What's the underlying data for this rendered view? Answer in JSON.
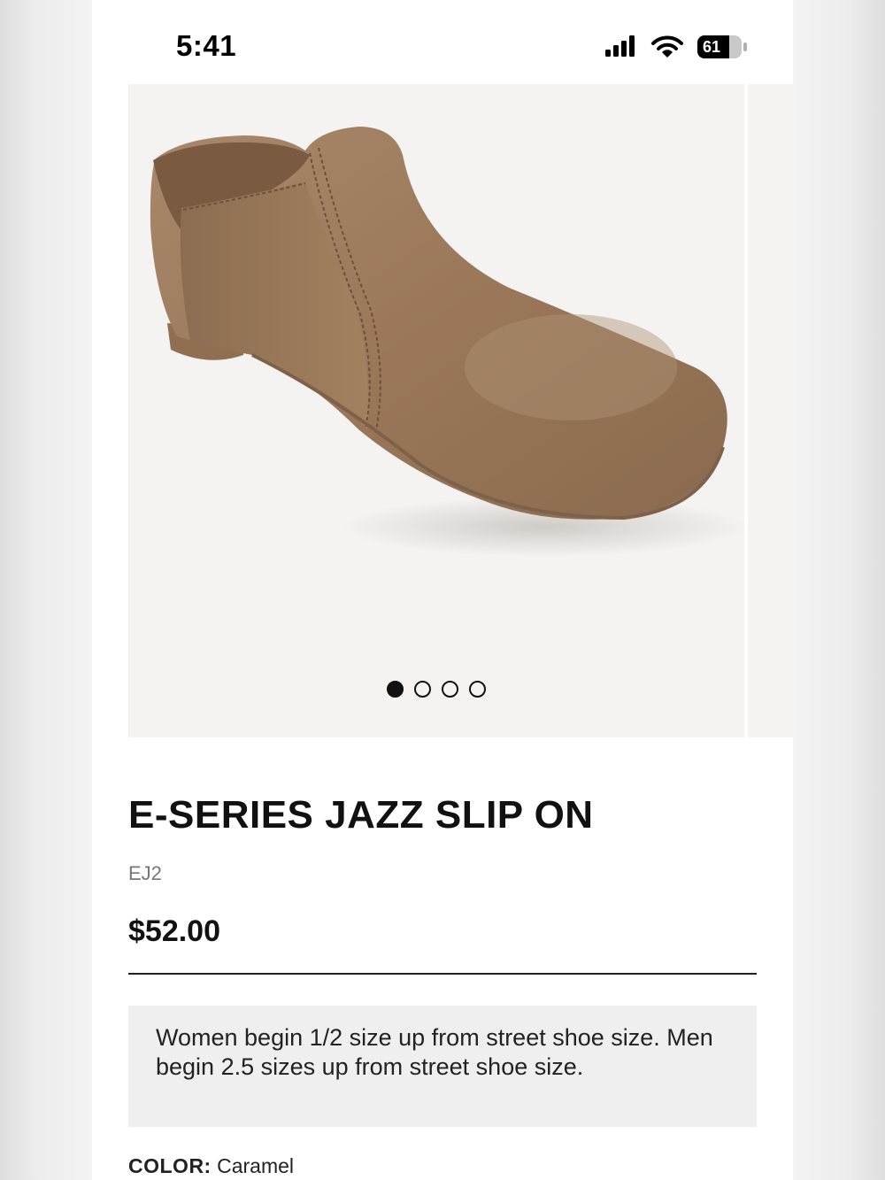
{
  "status_bar": {
    "time": "5:41",
    "battery": "61",
    "icons": [
      "signal-icon",
      "wifi-icon",
      "battery-icon"
    ]
  },
  "gallery": {
    "image": "shoe-image",
    "image_count": 4,
    "active_index": 0
  },
  "product": {
    "title": "E-SERIES JAZZ SLIP ON",
    "sku": "EJ2",
    "price": "$52.00",
    "size_note": "Women begin 1/2 size up from street shoe size. Men begin 2.5 sizes up from street shoe size.",
    "color_label": "COLOR:",
    "color_value": "Caramel"
  },
  "colors": {
    "shoe": "#9c7a5d",
    "note_bg": "#efefef",
    "text": "#111111"
  }
}
